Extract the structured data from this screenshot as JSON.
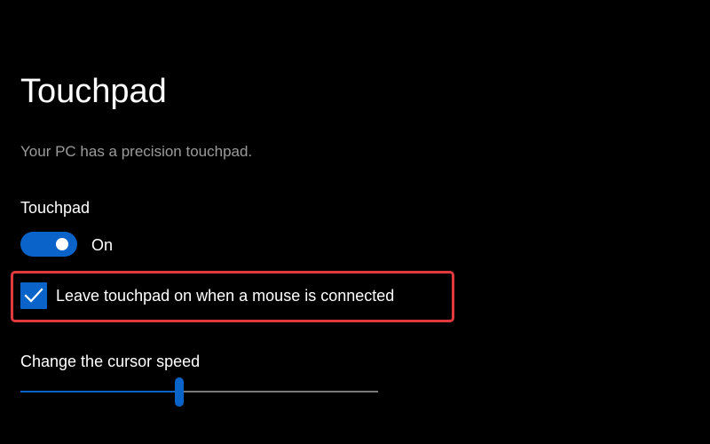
{
  "page": {
    "title": "Touchpad",
    "subtitle": "Your PC has a precision touchpad."
  },
  "touchpad_section": {
    "label": "Touchpad",
    "toggle_state": "On",
    "toggle_on": true
  },
  "mouse_option": {
    "label": "Leave touchpad on when a mouse is connected",
    "checked": true,
    "icon": "checkmark-icon"
  },
  "cursor_speed": {
    "label": "Change the cursor speed",
    "value_fraction": 0.445
  },
  "colors": {
    "accent": "#0a63c9",
    "highlight": "#e0393e",
    "background": "#000000",
    "secondary_text": "#9b9b9b"
  }
}
